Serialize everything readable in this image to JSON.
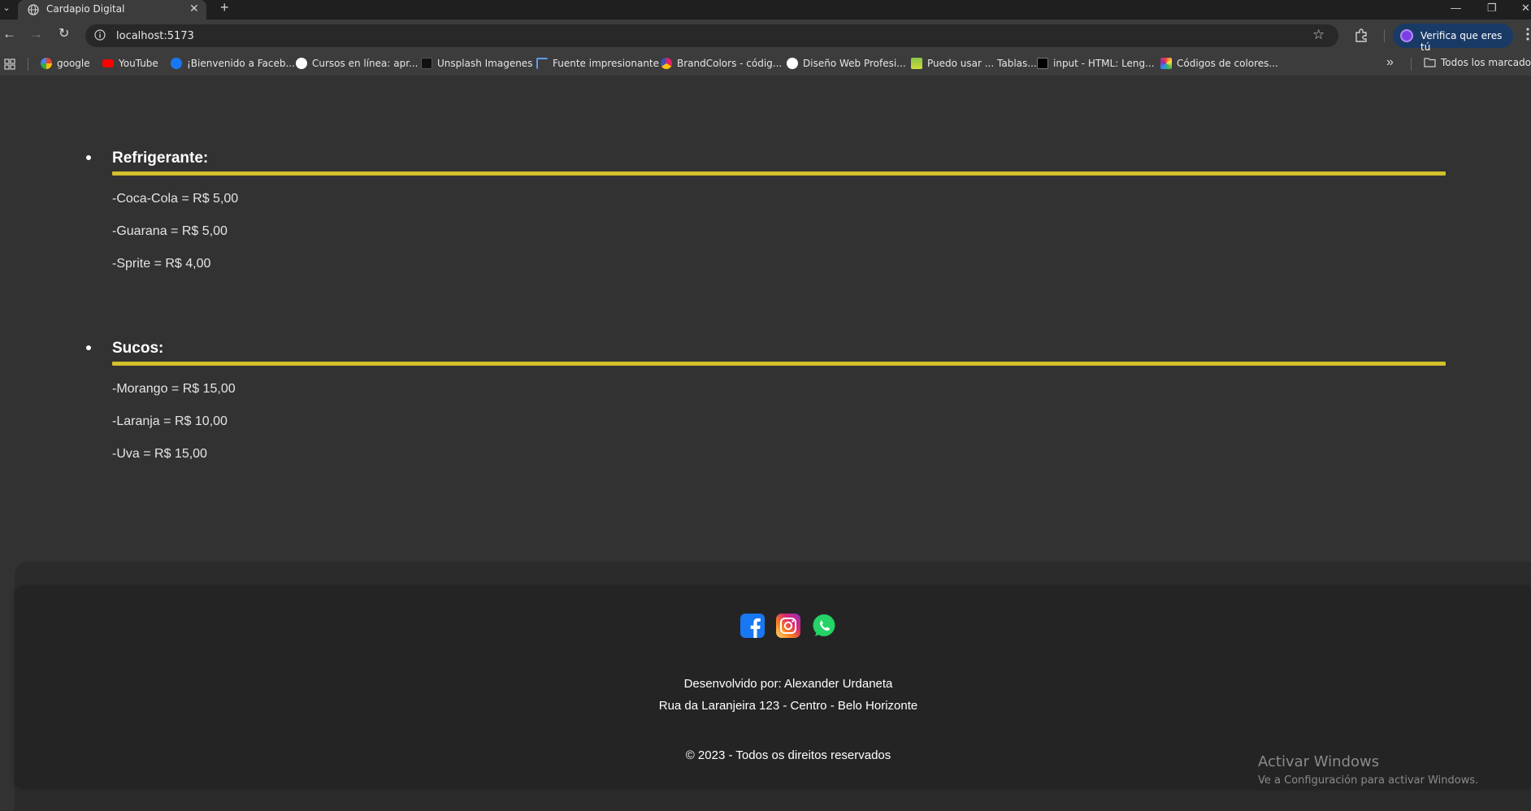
{
  "browser": {
    "tab_title": "Cardapio Digital",
    "url": "localhost:5173",
    "profile_label": "Verifica que eres tú",
    "bookmarks": [
      {
        "label": "google",
        "icon": "google-icon"
      },
      {
        "label": "YouTube",
        "icon": "youtube-icon"
      },
      {
        "label": "¡Bienvenido a Faceb...",
        "icon": "facebook-icon"
      },
      {
        "label": "Cursos en línea: apr...",
        "icon": "udemy-icon"
      },
      {
        "label": "Unsplash Imagenes",
        "icon": "unsplash-icon"
      },
      {
        "label": "Fuente impresionante",
        "icon": "flag-icon"
      },
      {
        "label": "BrandColors - códig...",
        "icon": "brandcolors-icon"
      },
      {
        "label": "Diseño Web Profesi...",
        "icon": "udemy-icon"
      },
      {
        "label": "Puedo usar ... Tablas...",
        "icon": "caniuse-icon"
      },
      {
        "label": "input - HTML: Leng...",
        "icon": "mdn-icon"
      },
      {
        "label": "Códigos de colores...",
        "icon": "color-wheel-icon"
      }
    ],
    "bookmarks_folder": "Todos los marcadores"
  },
  "menu": {
    "categories": [
      {
        "title": "Refrigerante:",
        "items": [
          "-Coca-Cola = R$ 5,00",
          "-Guarana = R$ 5,00",
          "-Sprite = R$ 4,00"
        ]
      },
      {
        "title": "Sucos:",
        "items": [
          "-Morango = R$ 15,00",
          "-Laranja = R$ 10,00",
          "-Uva = R$ 15,00"
        ]
      }
    ]
  },
  "footer": {
    "social": [
      "facebook-icon",
      "instagram-icon",
      "whatsapp-icon"
    ],
    "developer": "Desenvolvido por: Alexander Urdaneta",
    "address": "Rua da Laranjeira 123 - Centro - Belo Horizonte",
    "copyright": "© 2023 - Todos os direitos reservados"
  },
  "windows_watermark": {
    "title": "Activar Windows",
    "subtitle": "Ve a Configuración para activar Windows."
  },
  "colors": {
    "page_background": "#333233",
    "accent_rule": "#d4c02a",
    "footer_background": "#242424"
  }
}
